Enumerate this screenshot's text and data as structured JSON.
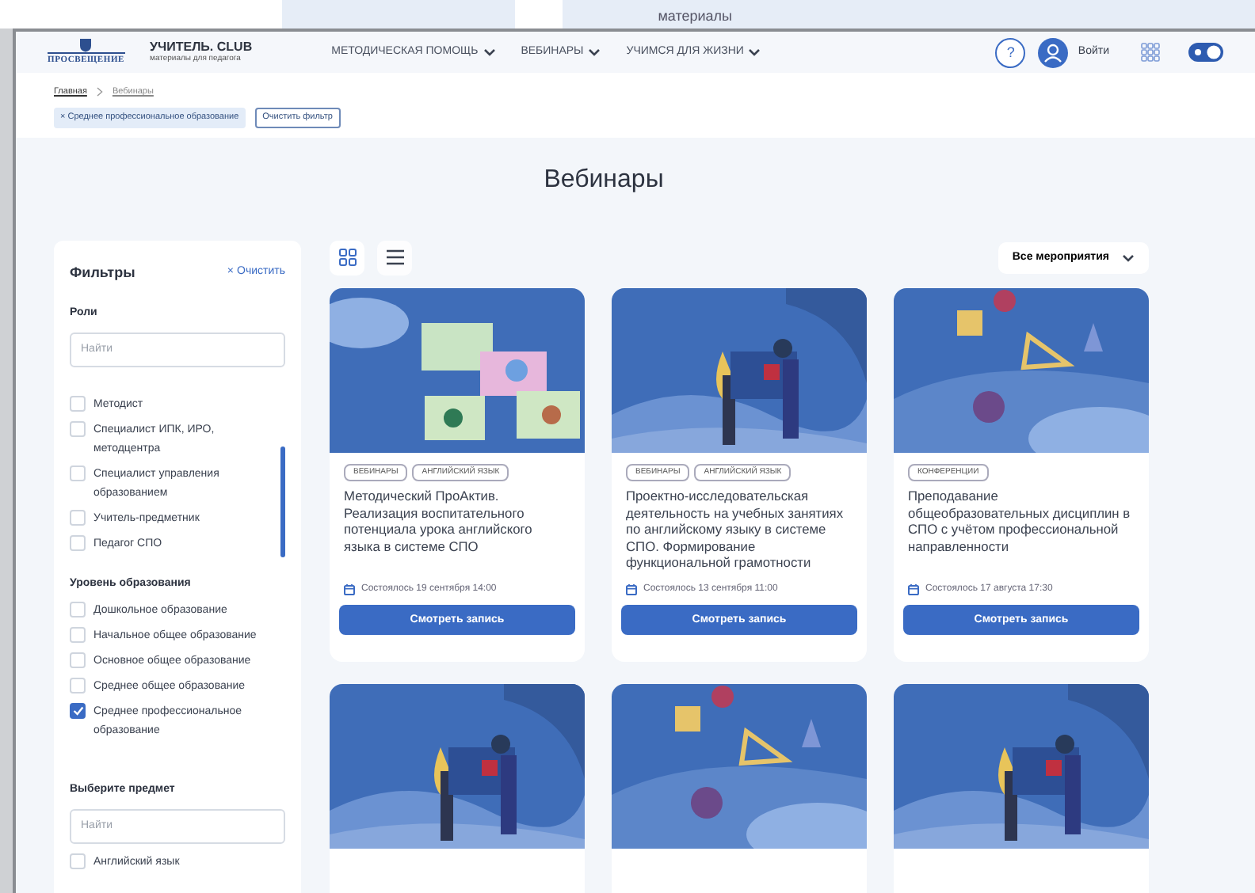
{
  "background_window": {
    "text": "материалы"
  },
  "header": {
    "brand": "ПРОСВЕЩЕНИЕ",
    "site_title": "УЧИТЕЛЬ. CLUB",
    "site_subtitle": "материалы для педагога",
    "nav": [
      "МЕТОДИЧЕСКАЯ ПОМОЩЬ",
      "ВЕБИНАРЫ",
      "УЧИМСЯ ДЛЯ ЖИЗНИ"
    ],
    "help": "?",
    "login": "Войти",
    "theme_toggle": {
      "on": true
    }
  },
  "breadcrumbs": [
    "Главная",
    "Вебинары"
  ],
  "active_filters": [
    {
      "remove": "×",
      "label": "Среднее профессиональное образование"
    }
  ],
  "clear_filter_button": "Очистить фильтр",
  "page_title": "Вебинары",
  "filters": {
    "title": "Фильтры",
    "clear_icon": "×",
    "clear": "Очистить",
    "groups": [
      {
        "title": "Роли",
        "search_placeholder": "Найти",
        "scrollable": true,
        "options": [
          {
            "label": "Методист",
            "checked": false
          },
          {
            "label": "Специалист ИПК, ИРО, методцентра",
            "checked": false
          },
          {
            "label": "Специалист управления образованием",
            "checked": false
          },
          {
            "label": "Учитель-предметник",
            "checked": false
          },
          {
            "label": "Педагог СПО",
            "checked": false
          }
        ]
      },
      {
        "title": "Уровень образования",
        "scrollable": false,
        "options": [
          {
            "label": "Дошкольное образование",
            "checked": false
          },
          {
            "label": "Начальное общее образование",
            "checked": false
          },
          {
            "label": "Основное общее образование",
            "checked": false
          },
          {
            "label": "Среднее общее образование",
            "checked": false
          },
          {
            "label": "Среднее профессиональное образование",
            "checked": true
          }
        ]
      },
      {
        "title": "Выберите предмет",
        "search_placeholder": "Найти",
        "scrollable": false,
        "options": [
          {
            "label": "Английский язык",
            "checked": false
          }
        ]
      }
    ]
  },
  "view_modes": [
    {
      "kind": "grid",
      "selected": true
    },
    {
      "kind": "list",
      "selected": false
    }
  ],
  "event_filter": "Все мероприятия",
  "cards": [
    {
      "kind": "picture",
      "tags": [
        "ВЕБИНАРЫ",
        "АНГЛИЙСКИЙ ЯЗЫК"
      ],
      "title": "Методический ПроАктив. Реализация воспитательного потенциала урока английского языка в системе СПО",
      "date": "Состоялось 19 сентября 14:00",
      "button": "Смотреть запись"
    },
    {
      "kind": "picture",
      "tags": [
        "ВЕБИНАРЫ",
        "АНГЛИЙСКИЙ ЯЗЫК"
      ],
      "title": "Проектно-исследовательская деятельность на учебных занятиях по английскому языку в системе СПО. Формирование функциональной грамотности",
      "date": "Состоялось 13 сентября 11:00",
      "button": "Смотреть запись"
    },
    {
      "kind": "picture",
      "tags": [
        "КОНФЕРЕНЦИИ"
      ],
      "title": "Преподавание общеобразовательных дисциплин в СПО с учётом профессиональной направленности",
      "date": "Состоялось 17 августа 17:30",
      "button": "Смотреть запись"
    },
    {
      "kind": "picture"
    },
    {
      "kind": "picture"
    },
    {
      "kind": "picture"
    }
  ]
}
